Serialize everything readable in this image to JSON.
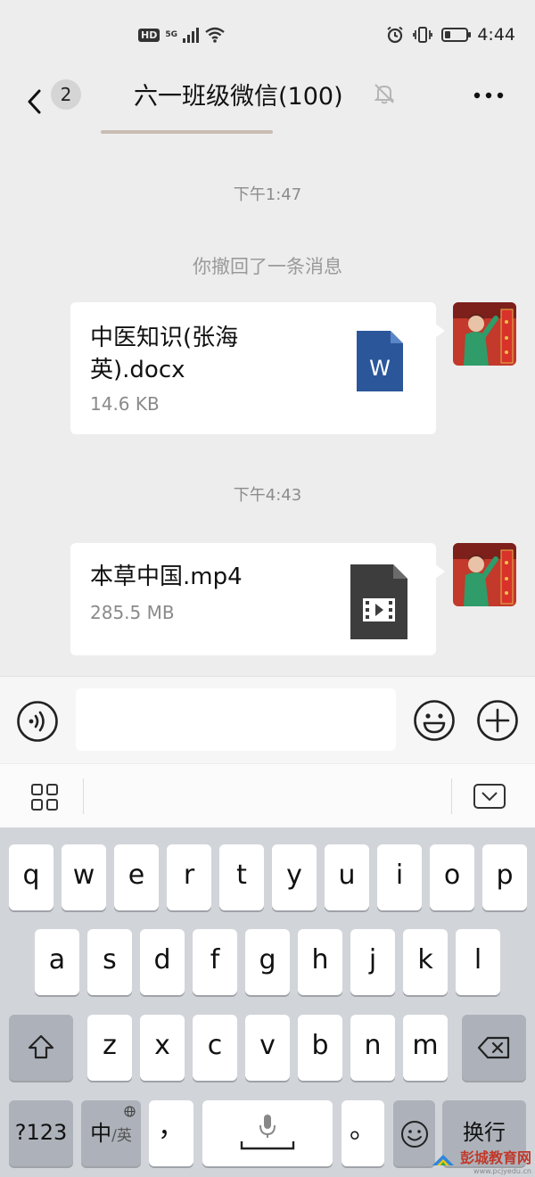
{
  "status_bar": {
    "hd": "HD",
    "network": "5G",
    "time": "4:44"
  },
  "header": {
    "back_badge": "2",
    "title": "六一班级微信(100)"
  },
  "chat": {
    "time_1": "下午1:47",
    "system_msg": "你撤回了一条消息",
    "file_1": {
      "name": "中医知识(张海英).docx",
      "size": "14.6 KB",
      "icon": "word-icon",
      "icon_letter": "W"
    },
    "time_2": "下午4:43",
    "file_2": {
      "name": "本草中国.mp4",
      "size": "285.5 MB",
      "icon": "video-file-icon"
    }
  },
  "keyboard": {
    "row1": [
      "q",
      "w",
      "e",
      "r",
      "t",
      "y",
      "u",
      "i",
      "o",
      "p"
    ],
    "row2": [
      "a",
      "s",
      "d",
      "f",
      "g",
      "h",
      "j",
      "k",
      "l"
    ],
    "row3": [
      "z",
      "x",
      "c",
      "v",
      "b",
      "n",
      "m"
    ],
    "num_key": "?123",
    "lang_key_main": "中",
    "lang_key_sub": "/英",
    "comma_key": "，",
    "period_key": "。",
    "enter_key": "换行"
  },
  "watermark": {
    "text": "彭城教育网",
    "url": "www.pcjyedu.cn"
  },
  "colors": {
    "accent": "#2b579a",
    "bg": "#ededed"
  }
}
